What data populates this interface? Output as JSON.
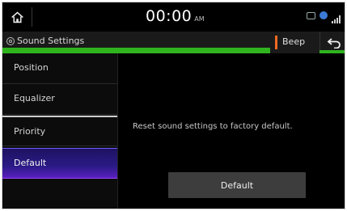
{
  "statusbar": {
    "time": "00:00",
    "ampm": "AM",
    "icons": [
      "home-icon",
      "bluetooth-battery-icon",
      "network-icon",
      "signal-icon"
    ]
  },
  "titlebar": {
    "title": "Sound Settings",
    "beep_label": "Beep",
    "accent_green": "#2fb41e",
    "beep_accent": "#f06a22"
  },
  "sidebar": {
    "items": [
      {
        "label": "Position"
      },
      {
        "label": "Equalizer"
      },
      {
        "label": "Priority"
      },
      {
        "label": "Default",
        "selected": true
      }
    ]
  },
  "content": {
    "message": "Reset sound settings to factory default.",
    "button_label": "Default"
  }
}
